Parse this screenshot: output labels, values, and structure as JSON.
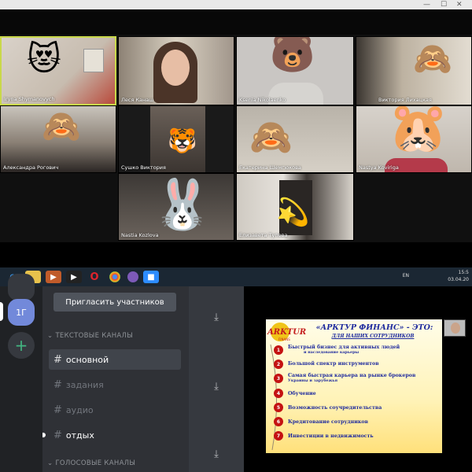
{
  "zoom": {
    "participants": [
      {
        "name": "Iryna Shymanovych",
        "emoji": "😻"
      },
      {
        "name": "Леся Канаш",
        "emoji": ""
      },
      {
        "name": "Ksenia Nikolaenko",
        "emoji": "🐻"
      },
      {
        "name": "Виктория Лихацкая",
        "emoji": "🙈"
      },
      {
        "name": "Александра Рогович",
        "emoji": "🙈"
      },
      {
        "name": "Сушко Виктория",
        "emoji": "🐯"
      },
      {
        "name": "Екатерина Шемгюкова",
        "emoji": "🙈"
      },
      {
        "name": "Nastya Koviriga",
        "emoji": "🐹"
      },
      {
        "name": "Nastia Kozlova",
        "emoji": "🐰"
      },
      {
        "name": "Елизавета Тупова",
        "emoji": "💫"
      }
    ]
  },
  "taskbar": {
    "lang": "EN",
    "time": "15:5",
    "date": "03.04.20"
  },
  "discord": {
    "server_label": "1Г",
    "add_server": "+",
    "invite_button": "Пригласить участников",
    "text_category": "ТЕКСТОВЫЕ КАНАЛЫ",
    "voice_category": "ГОЛОСОВЫЕ КАНАЛЫ",
    "channels": [
      {
        "name": "основной"
      },
      {
        "name": "задания"
      },
      {
        "name": "аудио"
      },
      {
        "name": "отдых"
      }
    ]
  },
  "slide": {
    "logo": "ARKTUR",
    "logo_sub": "FINANS",
    "title": "«АРКТУР ФИНАНС» - ЭТО:",
    "subtitle": "ДЛЯ НАШИХ СОТРУДНИКОВ",
    "points": [
      {
        "num": "1",
        "text": "Быстрый бизнес для активных людей",
        "sub": "и наследование карьеры"
      },
      {
        "num": "2",
        "text": "Большой спектр инструментов",
        "sub": ""
      },
      {
        "num": "3",
        "text": "Самая быстрая карьера на рынке брокеров",
        "sub": "Украины и зарубежья"
      },
      {
        "num": "4",
        "text": "Обучение",
        "sub": ""
      },
      {
        "num": "5",
        "text": "Возможность соучредительства",
        "sub": ""
      },
      {
        "num": "6",
        "text": "Кредитование сотрудников",
        "sub": ""
      },
      {
        "num": "7",
        "text": "Инвестиции в недвижимость",
        "sub": ""
      }
    ]
  },
  "colors": {
    "discord_bg": "#2f3136",
    "discord_servers": "#202225",
    "discord_blurple": "#7289da",
    "taskbar": "#1b2733",
    "slide_blue": "#1d2a9e",
    "slide_red": "#c41212"
  }
}
